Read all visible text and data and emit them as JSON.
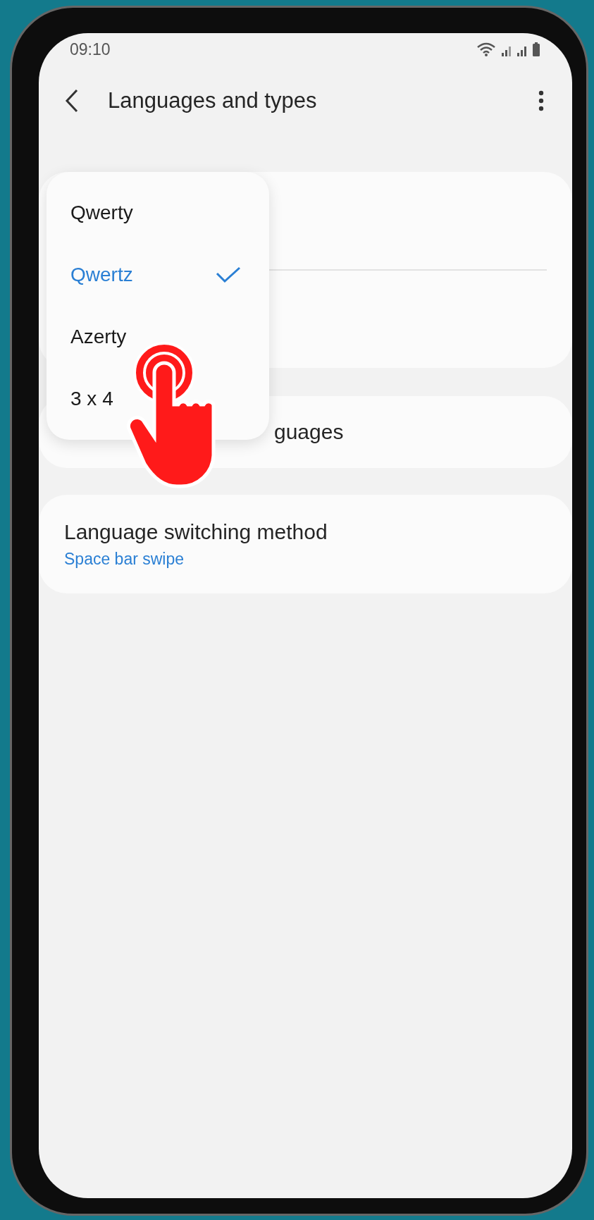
{
  "status_bar": {
    "time": "09:10"
  },
  "header": {
    "title": "Languages and types"
  },
  "cards": [
    {
      "kind": "covered"
    },
    {
      "kind": "partial",
      "title": "guages"
    },
    {
      "kind": "setting",
      "title": "Language switching method",
      "value": "Space bar swipe"
    }
  ],
  "dropdown": {
    "options": [
      {
        "label": "Qwerty",
        "selected": false
      },
      {
        "label": "Qwertz",
        "selected": true
      },
      {
        "label": "Azerty",
        "selected": false
      },
      {
        "label": "3 x 4",
        "selected": false
      }
    ]
  }
}
